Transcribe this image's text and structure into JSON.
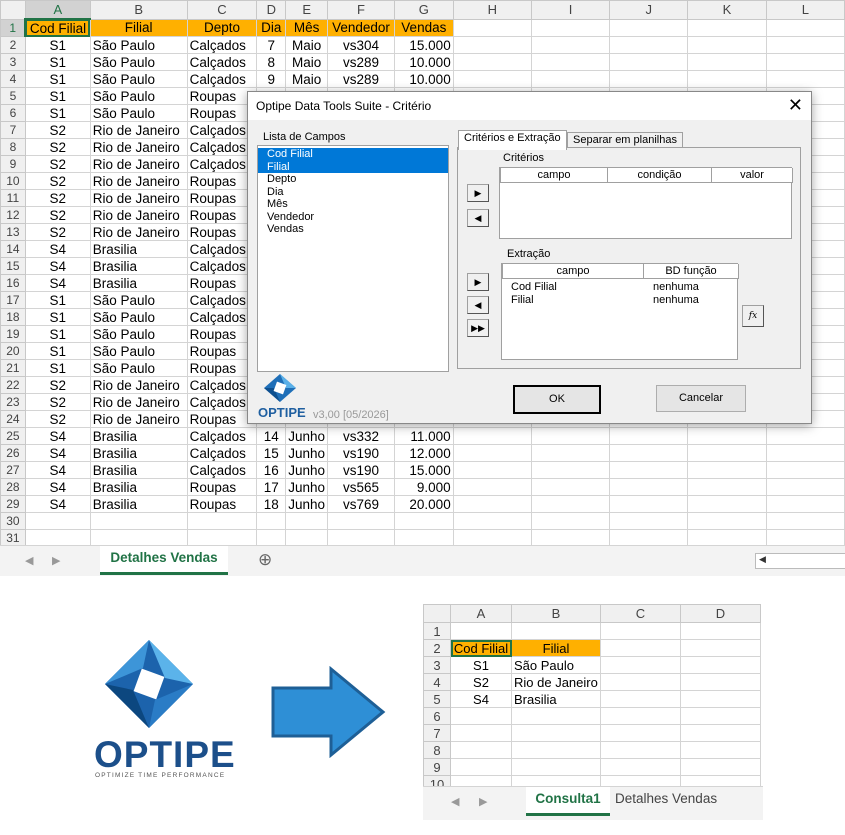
{
  "main_sheet": {
    "columns": [
      "A",
      "B",
      "C",
      "D",
      "E",
      "F",
      "G",
      "H",
      "I",
      "J",
      "K",
      "L"
    ],
    "header_row": [
      "Cod Filial",
      "Filial",
      "Depto",
      "Dia",
      "Mês",
      "Vendedor",
      "Vendas"
    ],
    "rows": [
      [
        "S1",
        "São Paulo",
        "Calçados",
        "7",
        "Maio",
        "vs304",
        "15.000"
      ],
      [
        "S1",
        "São Paulo",
        "Calçados",
        "8",
        "Maio",
        "vs289",
        "10.000"
      ],
      [
        "S1",
        "São Paulo",
        "Calçados",
        "9",
        "Maio",
        "vs289",
        "10.000"
      ],
      [
        "S1",
        "São Paulo",
        "Roupas",
        "",
        "",
        "",
        ""
      ],
      [
        "S1",
        "São Paulo",
        "Roupas",
        "",
        "",
        "",
        ""
      ],
      [
        "S2",
        "Rio de Janeiro",
        "Calçados",
        "",
        "",
        "",
        ""
      ],
      [
        "S2",
        "Rio de Janeiro",
        "Calçados",
        "",
        "",
        "",
        ""
      ],
      [
        "S2",
        "Rio de Janeiro",
        "Calçados",
        "",
        "",
        "",
        ""
      ],
      [
        "S2",
        "Rio de Janeiro",
        "Roupas",
        "",
        "",
        "",
        ""
      ],
      [
        "S2",
        "Rio de Janeiro",
        "Roupas",
        "",
        "",
        "",
        ""
      ],
      [
        "S2",
        "Rio de Janeiro",
        "Roupas",
        "",
        "",
        "",
        ""
      ],
      [
        "S2",
        "Rio de Janeiro",
        "Roupas",
        "",
        "",
        "",
        ""
      ],
      [
        "S4",
        "Brasilia",
        "Calçados",
        "",
        "",
        "",
        ""
      ],
      [
        "S4",
        "Brasilia",
        "Calçados",
        "",
        "",
        "",
        ""
      ],
      [
        "S4",
        "Brasilia",
        "Roupas",
        "",
        "",
        "",
        ""
      ],
      [
        "S1",
        "São Paulo",
        "Calçados",
        "",
        "",
        "",
        ""
      ],
      [
        "S1",
        "São Paulo",
        "Calçados",
        "",
        "",
        "",
        ""
      ],
      [
        "S1",
        "São Paulo",
        "Roupas",
        "",
        "",
        "",
        ""
      ],
      [
        "S1",
        "São Paulo",
        "Roupas",
        "",
        "",
        "",
        ""
      ],
      [
        "S1",
        "São Paulo",
        "Roupas",
        "",
        "",
        "",
        ""
      ],
      [
        "S2",
        "Rio de Janeiro",
        "Calçados",
        "",
        "",
        "",
        ""
      ],
      [
        "S2",
        "Rio de Janeiro",
        "Calçados",
        "",
        "",
        "",
        ""
      ],
      [
        "S2",
        "Rio de Janeiro",
        "Roupas",
        "13",
        "Junho",
        "vs193",
        "19.000"
      ],
      [
        "S4",
        "Brasilia",
        "Calçados",
        "14",
        "Junho",
        "vs332",
        "11.000"
      ],
      [
        "S4",
        "Brasilia",
        "Calçados",
        "15",
        "Junho",
        "vs190",
        "12.000"
      ],
      [
        "S4",
        "Brasilia",
        "Calçados",
        "16",
        "Junho",
        "vs190",
        "15.000"
      ],
      [
        "S4",
        "Brasilia",
        "Roupas",
        "17",
        "Junho",
        "vs565",
        "9.000"
      ],
      [
        "S4",
        "Brasilia",
        "Roupas",
        "18",
        "Junho",
        "vs769",
        "20.000"
      ],
      [
        "",
        "",
        "",
        "",
        "",
        "",
        ""
      ],
      [
        "",
        "",
        "",
        "",
        "",
        "",
        ""
      ]
    ],
    "row_numbers": [
      "1",
      "2",
      "3",
      "4",
      "5",
      "6",
      "7",
      "8",
      "9",
      "10",
      "11",
      "12",
      "13",
      "14",
      "15",
      "16",
      "17",
      "18",
      "19",
      "20",
      "21",
      "22",
      "23",
      "24",
      "25",
      "26",
      "27",
      "28",
      "29",
      "30",
      "31"
    ],
    "tab_label": "Detalhes Vendas",
    "add_sheet": "⊕"
  },
  "dialog": {
    "title": "Optipe Data Tools Suite - Critério",
    "close": "✕",
    "fields_label": "Lista de Campos",
    "fields": [
      "Cod Filial",
      "Filial",
      "Depto",
      "Dia",
      "Mês",
      "Vendedor",
      "Vendas"
    ],
    "tab_active": "Critérios e Extração",
    "tab_other": "Separar em planilhas",
    "criteria_label": "Critérios",
    "criteria_cols": [
      "campo",
      "condição",
      "valor"
    ],
    "extraction_label": "Extração",
    "extraction_cols": [
      "campo",
      "BD função"
    ],
    "extraction_rows": [
      [
        "Cod Filial",
        "nenhuma"
      ],
      [
        "Filial",
        "nenhuma"
      ]
    ],
    "fx": "fx",
    "ok": "OK",
    "cancel": "Cancelar",
    "brand": "OPTIPE",
    "version": "v3,00 [05/2026]",
    "arrow_right": "▶",
    "arrow_left": "◀",
    "arrow_double": "▶▶"
  },
  "logo": {
    "brand": "OPTIPE",
    "tagline": "OPTIMIZE TIME PERFORMANCE"
  },
  "result_sheet": {
    "columns": [
      "A",
      "B",
      "C",
      "D"
    ],
    "row_numbers": [
      "1",
      "2",
      "3",
      "4",
      "5",
      "6",
      "7",
      "8",
      "9",
      "10"
    ],
    "header": [
      "Cod Filial",
      "Filial"
    ],
    "rows": [
      [
        "S1",
        "São Paulo"
      ],
      [
        "S2",
        "Rio de Janeiro"
      ],
      [
        "S4",
        "Brasilia"
      ]
    ],
    "tab_active": "Consulta1",
    "tab_other": "Detalhes Vendas"
  },
  "colors": {
    "header_fill": "#ffb000",
    "excel_green": "#217346",
    "selection_blue": "#0078d7",
    "arrow_blue": "#2e8fd6"
  }
}
